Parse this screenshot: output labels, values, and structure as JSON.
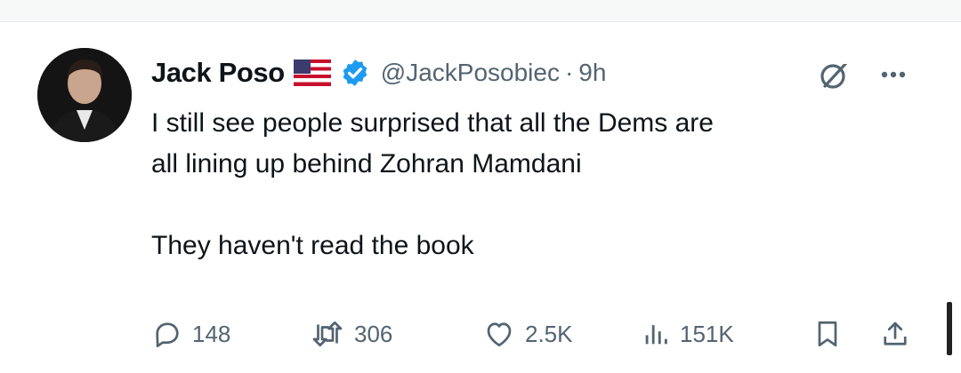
{
  "tweet": {
    "author_name": "Jack Poso",
    "handle": "@JackPosobiec",
    "separator": "·",
    "time": "9h",
    "text_lines": [
      "I still see people surprised that all the Dems are",
      "all lining up behind Zohran Mamdani"
    ],
    "text_line2": "They haven't read the book",
    "icons": {
      "flag": "us-flag-icon",
      "verified": "verified-badge-icon",
      "grok": "grok-icon",
      "more": "more-options-icon"
    }
  },
  "actions": {
    "reply_count": "148",
    "retweet_count": "306",
    "like_count": "2.5K",
    "views_count": "151K"
  },
  "colors": {
    "verified_blue": "#1d9bf0",
    "muted_text": "#536471",
    "primary_text": "#0f1419"
  }
}
